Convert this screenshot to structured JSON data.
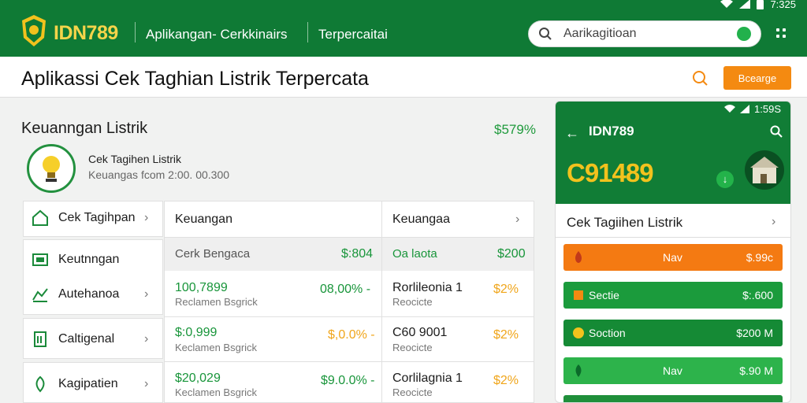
{
  "status": {
    "time": "7:325"
  },
  "header": {
    "brand": "IDN789",
    "nav": [
      "Aplikangan- Cerkkinairs",
      "Terpercaitai"
    ],
    "search_value": "Aarikagitioan"
  },
  "title_bar": {
    "title": "Aplikassi Cek Taghian Listrik Terpercata",
    "button": "Bcearge"
  },
  "section": {
    "title": "Keuanngan Listrik",
    "percent": "$579%",
    "bulb_title": "Cek Tagihen Listrik",
    "bulb_sub": "Keuangas fcom 2:00. 00.300"
  },
  "side_menu": [
    {
      "label": "Cek Tagihpan"
    },
    {
      "label": "Keutnngan"
    },
    {
      "label": "Autehanoa"
    },
    {
      "label": "Caltigenal"
    },
    {
      "label": "Kagipatien"
    }
  ],
  "table": {
    "col1_head": "Keuangan",
    "col2_head": "Keuangaa",
    "grey_row": {
      "a_label": "Cerk Bengaca",
      "a_value": "$:804",
      "b_label": "Oa laota",
      "b_value": "$200"
    },
    "rows": [
      {
        "amount": "100,7899",
        "sub": "Reclamen Bsgrick",
        "pct": "08,00% -",
        "b_amount": "Rorlileonia 1",
        "b_sub": "Reocicte",
        "b_pct": "$2%"
      },
      {
        "amount": "$:0,999",
        "sub": "Keclamen Bsgrick",
        "pct": "$,0.0% -",
        "b_amount": "C60 9001",
        "b_sub": "Reocicte",
        "b_pct": "$2%"
      },
      {
        "amount": "$20,029",
        "sub": "Keclamen Bsgrick",
        "pct": "$9.0.0% -",
        "b_amount": "Corlilagnia 1",
        "b_sub": "Reocicte",
        "b_pct": "$2%"
      }
    ]
  },
  "phone": {
    "time": "1:59S",
    "brand": "IDN789",
    "big_number": "C91489",
    "row_title": "Cek Tagiihen Listrik",
    "bars": [
      {
        "label": "Nav",
        "value": "$.99c",
        "color": "#f47a12"
      },
      {
        "label": "Sectie",
        "value": "$:.600",
        "color": "#1b9b3c"
      },
      {
        "label": "Soction",
        "value": "$200 M",
        "color": "#158a35"
      },
      {
        "label": "Nav",
        "value": "$.90 M",
        "color": "#2db34b"
      },
      {
        "label": "",
        "value": "",
        "color": "#1f8f3a"
      }
    ]
  },
  "colors": {
    "brand_green": "#0f7a35",
    "accent_orange": "#f48a11",
    "brand_yellow": "#f5d44a"
  }
}
